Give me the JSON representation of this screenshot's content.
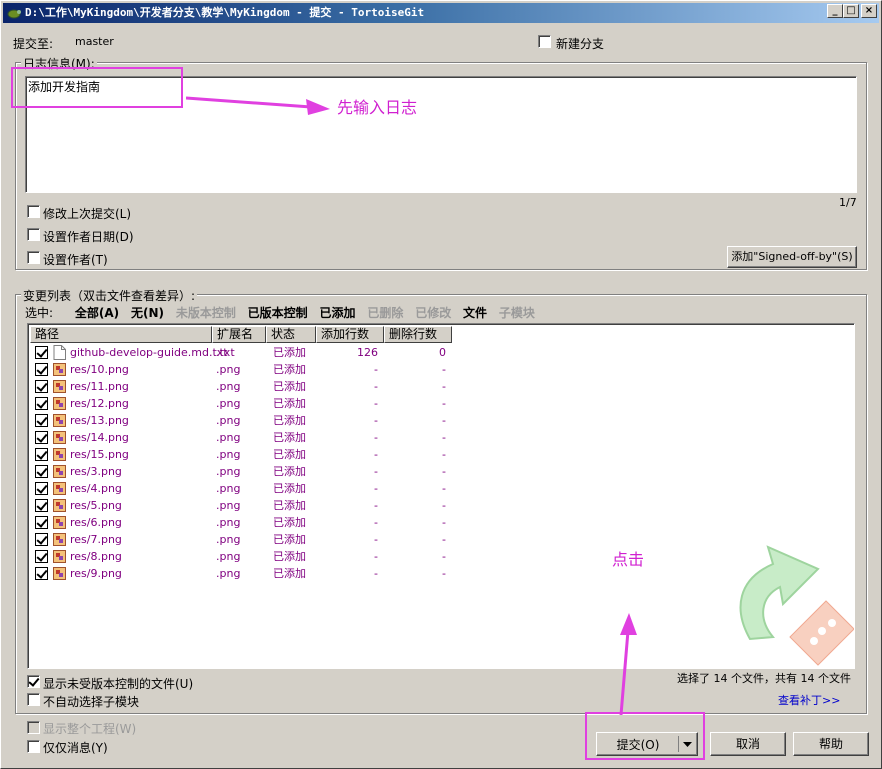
{
  "window": {
    "title": "D:\\工作\\MyKingdom\\开发者分支\\教学\\MyKingdom - 提交 - TortoiseGit",
    "min_glyph": "_",
    "max_glyph": "□",
    "close_glyph": "×"
  },
  "header": {
    "commit_to_label": "提交至:",
    "branch_name": "master",
    "new_branch_label": "新建分支"
  },
  "message": {
    "group_label": "日志信息(M):",
    "text": "添加开发指南",
    "line_indicator": "1/7",
    "amend_label": "修改上次提交(L)",
    "set_author_date_label": "设置作者日期(D)",
    "set_author_label": "设置作者(T)",
    "signed_off_button": "添加\"Signed-off-by\"(S)"
  },
  "changes": {
    "group_label": "变更列表（双击文件查看差异）:",
    "select_label": "选中:",
    "select_filters": [
      {
        "label": "全部(A)",
        "enabled": true
      },
      {
        "label": "无(N)",
        "enabled": true
      },
      {
        "label": "未版本控制",
        "enabled": false
      },
      {
        "label": "已版本控制",
        "enabled": true
      },
      {
        "label": "已添加",
        "enabled": true
      },
      {
        "label": "已删除",
        "enabled": false
      },
      {
        "label": "已修改",
        "enabled": false
      },
      {
        "label": "文件",
        "enabled": true
      },
      {
        "label": "子模块",
        "enabled": false
      }
    ],
    "columns": [
      "路径",
      "扩展名",
      "状态",
      "添加行数",
      "删除行数"
    ],
    "rows": [
      {
        "path": "github-develop-guide.md.txt",
        "ext": ".txt",
        "status": "已添加",
        "added": "126",
        "deleted": "0",
        "icon": "text-file-icon"
      },
      {
        "path": "res/10.png",
        "ext": ".png",
        "status": "已添加",
        "added": "-",
        "deleted": "-",
        "icon": "image-file-icon"
      },
      {
        "path": "res/11.png",
        "ext": ".png",
        "status": "已添加",
        "added": "-",
        "deleted": "-",
        "icon": "image-file-icon"
      },
      {
        "path": "res/12.png",
        "ext": ".png",
        "status": "已添加",
        "added": "-",
        "deleted": "-",
        "icon": "image-file-icon"
      },
      {
        "path": "res/13.png",
        "ext": ".png",
        "status": "已添加",
        "added": "-",
        "deleted": "-",
        "icon": "image-file-icon"
      },
      {
        "path": "res/14.png",
        "ext": ".png",
        "status": "已添加",
        "added": "-",
        "deleted": "-",
        "icon": "image-file-icon"
      },
      {
        "path": "res/15.png",
        "ext": ".png",
        "status": "已添加",
        "added": "-",
        "deleted": "-",
        "icon": "image-file-icon"
      },
      {
        "path": "res/3.png",
        "ext": ".png",
        "status": "已添加",
        "added": "-",
        "deleted": "-",
        "icon": "image-file-icon"
      },
      {
        "path": "res/4.png",
        "ext": ".png",
        "status": "已添加",
        "added": "-",
        "deleted": "-",
        "icon": "image-file-icon"
      },
      {
        "path": "res/5.png",
        "ext": ".png",
        "status": "已添加",
        "added": "-",
        "deleted": "-",
        "icon": "image-file-icon"
      },
      {
        "path": "res/6.png",
        "ext": ".png",
        "status": "已添加",
        "added": "-",
        "deleted": "-",
        "icon": "image-file-icon"
      },
      {
        "path": "res/7.png",
        "ext": ".png",
        "status": "已添加",
        "added": "-",
        "deleted": "-",
        "icon": "image-file-icon"
      },
      {
        "path": "res/8.png",
        "ext": ".png",
        "status": "已添加",
        "added": "-",
        "deleted": "-",
        "icon": "image-file-icon"
      },
      {
        "path": "res/9.png",
        "ext": ".png",
        "status": "已添加",
        "added": "-",
        "deleted": "-",
        "icon": "image-file-icon"
      }
    ],
    "show_unversioned_label": "显示未受版本控制的文件(U)",
    "no_auto_submodule_label": "不自动选择子模块",
    "selection_summary": "选择了 14 个文件，共有 14 个文件",
    "view_patch_link": "查看补丁>>"
  },
  "footer": {
    "show_whole_project_label": "显示整个工程(W)",
    "message_only_label": "仅仅消息(Y)",
    "commit_button": "提交(O)",
    "cancel_button": "取消",
    "help_button": "帮助"
  },
  "annotations": {
    "enter_log_text": "先输入日志",
    "click_text": "点击",
    "color": "#e040e0"
  },
  "colors": {
    "title_start": "#0a246a",
    "title_end": "#a6caf0",
    "row_text": "#800080",
    "link": "#0000cc",
    "face": "#d4d0c8"
  }
}
